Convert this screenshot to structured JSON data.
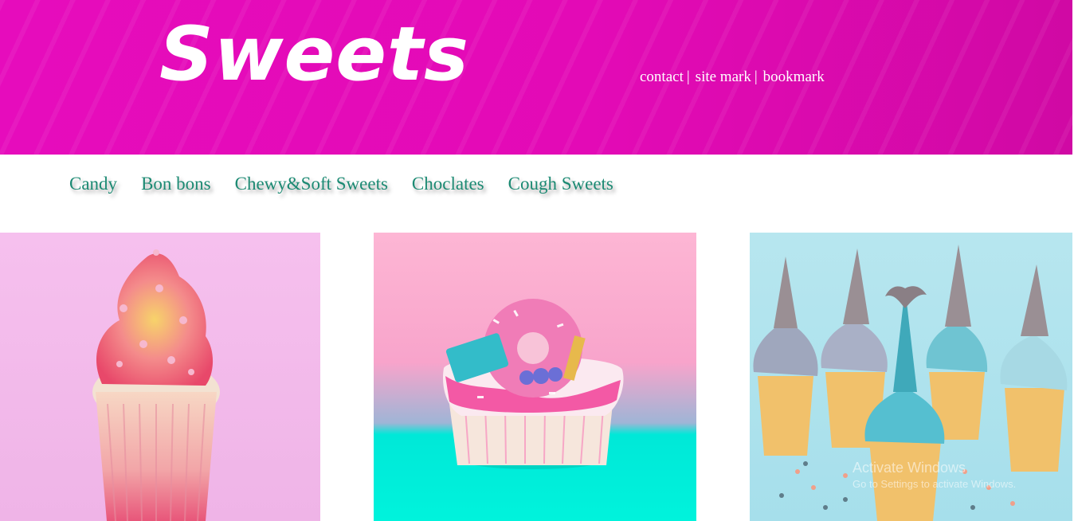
{
  "header": {
    "logo": "Sweets",
    "links": [
      "contact",
      "site mark",
      "bookmark"
    ],
    "separator": "|"
  },
  "nav": {
    "items": [
      "Candy",
      "Bon bons",
      "Chewy&Soft Sweets",
      "Choclates",
      "Cough Sweets"
    ]
  },
  "gallery": {
    "photos": [
      "pink swirl cupcake",
      "donut-topped sprinkle cupcake",
      "mermaid tail cupcakes"
    ]
  },
  "watermark": {
    "line1": "Activate Windows",
    "line2": "Go to Settings to activate Windows."
  },
  "colors": {
    "header_bg": "#e60cbc",
    "nav_text": "#1c8a73",
    "header_text": "#ffffff"
  }
}
